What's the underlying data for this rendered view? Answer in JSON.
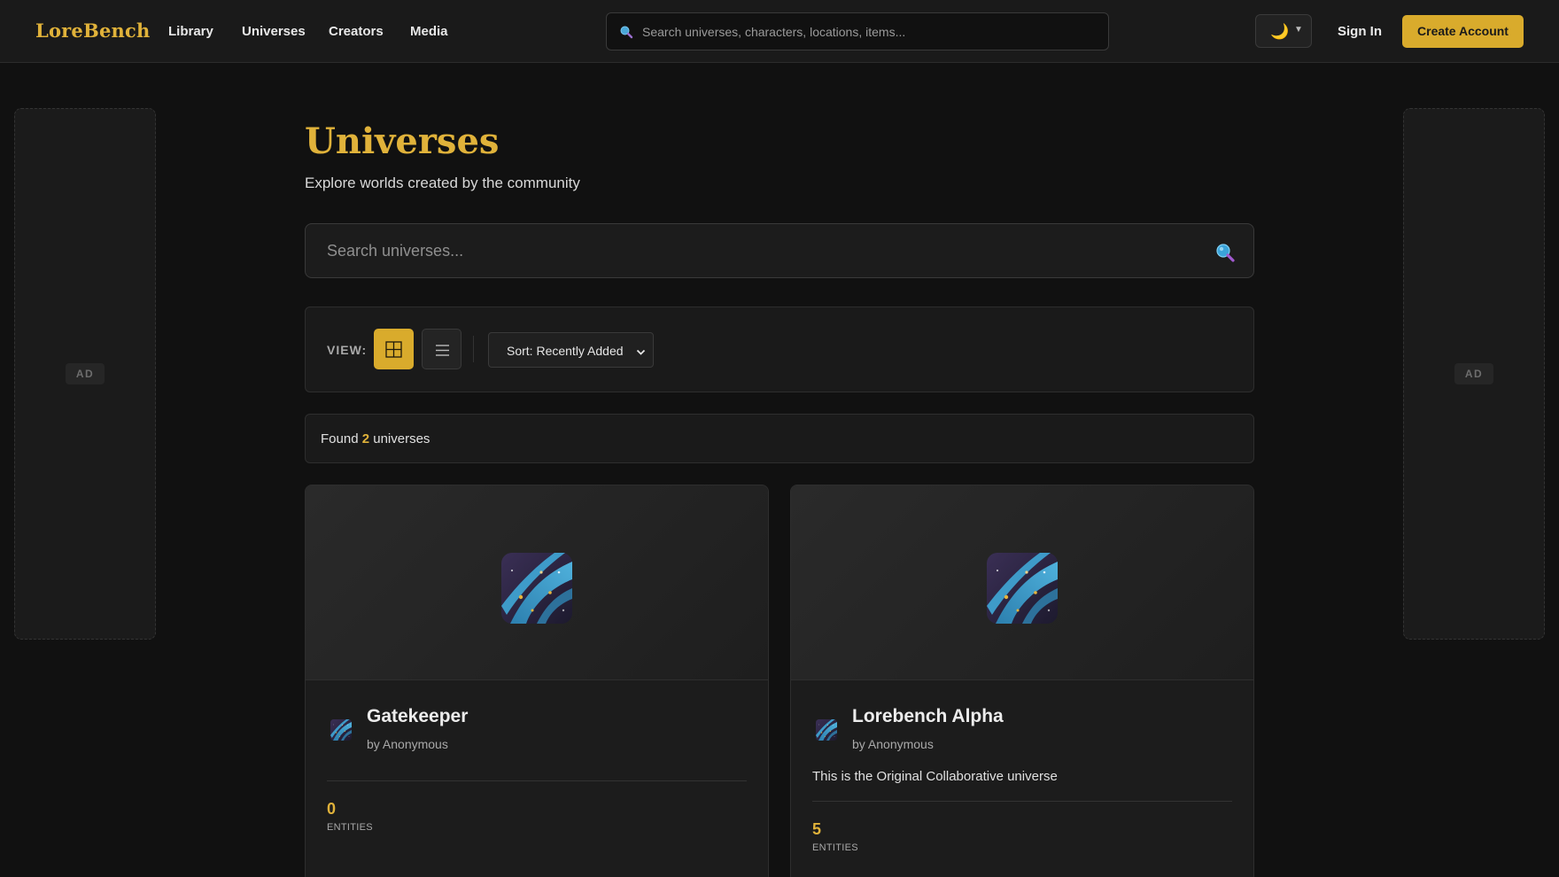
{
  "header": {
    "logo": "LoreBench",
    "nav": [
      "Library",
      "Universes",
      "Creators",
      "Media"
    ],
    "search_placeholder": "Search universes, characters, locations, items...",
    "theme_icon": "moon-icon",
    "sign_in": "Sign In",
    "create_account": "Create Account"
  },
  "ads": {
    "left": "AD",
    "right": "AD"
  },
  "main": {
    "title": "Universes",
    "subtitle": "Explore worlds created by the community",
    "search_placeholder": "Search universes...",
    "view_label": "VIEW:",
    "sort_label": "Sort: Recently Added",
    "found_prefix": "Found",
    "found_count": "2",
    "found_suffix": "universes"
  },
  "cards": [
    {
      "title": "Gatekeeper",
      "author": "by Anonymous",
      "description": "",
      "entities": "0",
      "entities_label": "ENTITIES"
    },
    {
      "title": "Lorebench Alpha",
      "author": "by Anonymous",
      "description": "This is the Original Collaborative universe",
      "entities": "5",
      "entities_label": "ENTITIES"
    }
  ],
  "colors": {
    "accent": "#e0b23a",
    "button": "#d9ab2c",
    "background": "#111111",
    "surface": "#1a1a1a"
  }
}
